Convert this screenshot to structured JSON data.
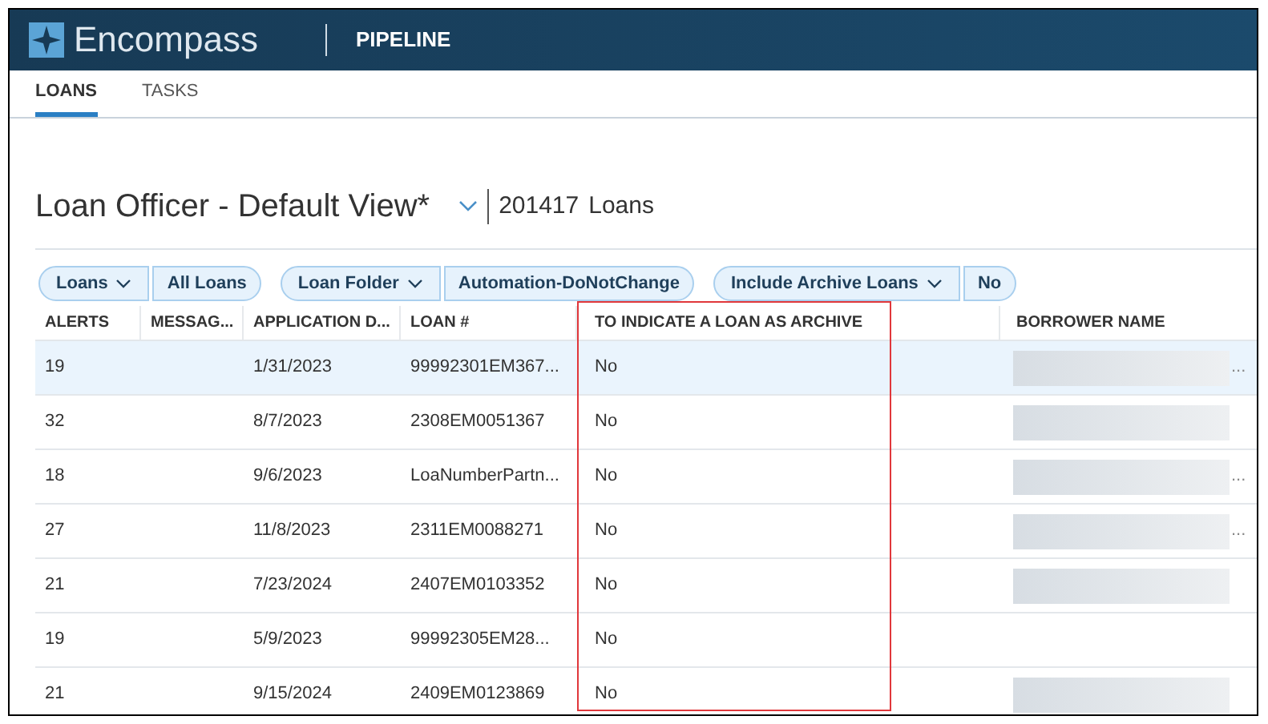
{
  "header": {
    "brand": "Encompass",
    "section": "PIPELINE"
  },
  "tabs": [
    {
      "label": "LOANS",
      "selected": true
    },
    {
      "label": "TASKS",
      "selected": false
    }
  ],
  "view": {
    "title": "Loan Officer - Default View*",
    "count": "201417",
    "count_label": "Loans"
  },
  "filters": [
    {
      "label": "Loans",
      "value": "All Loans"
    },
    {
      "label": "Loan Folder",
      "value": "Automation-DoNotChange"
    },
    {
      "label": "Include Archive Loans",
      "value": "No"
    }
  ],
  "table": {
    "columns": [
      "ALERTS",
      "MESSAG...",
      "APPLICATION D...",
      "LOAN #",
      "TO INDICATE A LOAN AS ARCHIVE",
      "BORROWER NAME"
    ],
    "rows": [
      {
        "selected": true,
        "cells": [
          "19",
          "",
          "1/31/2023",
          "99992301EM367...",
          "No"
        ],
        "borrower_redacted": true,
        "borrower_tail": "..."
      },
      {
        "selected": false,
        "cells": [
          "32",
          "",
          "8/7/2023",
          "2308EM0051367",
          "No"
        ],
        "borrower_redacted": true
      },
      {
        "selected": false,
        "cells": [
          "18",
          "",
          "9/6/2023",
          "LoaNumberPartn...",
          "No"
        ],
        "borrower_redacted": true,
        "borrower_tail": "..."
      },
      {
        "selected": false,
        "cells": [
          "27",
          "",
          "11/8/2023",
          "2311EM0088271",
          "No"
        ],
        "borrower_redacted": true,
        "borrower_tail": "..."
      },
      {
        "selected": false,
        "cells": [
          "21",
          "",
          "7/23/2024",
          "2407EM0103352",
          "No"
        ],
        "borrower_redacted": true
      },
      {
        "selected": false,
        "cells": [
          "19",
          "",
          "5/9/2023",
          "99992305EM28...",
          "No"
        ],
        "borrower_redacted": false
      },
      {
        "selected": false,
        "cells": [
          "21",
          "",
          "9/15/2024",
          "2409EM0123869",
          "No"
        ],
        "borrower_redacted": true
      }
    ]
  }
}
